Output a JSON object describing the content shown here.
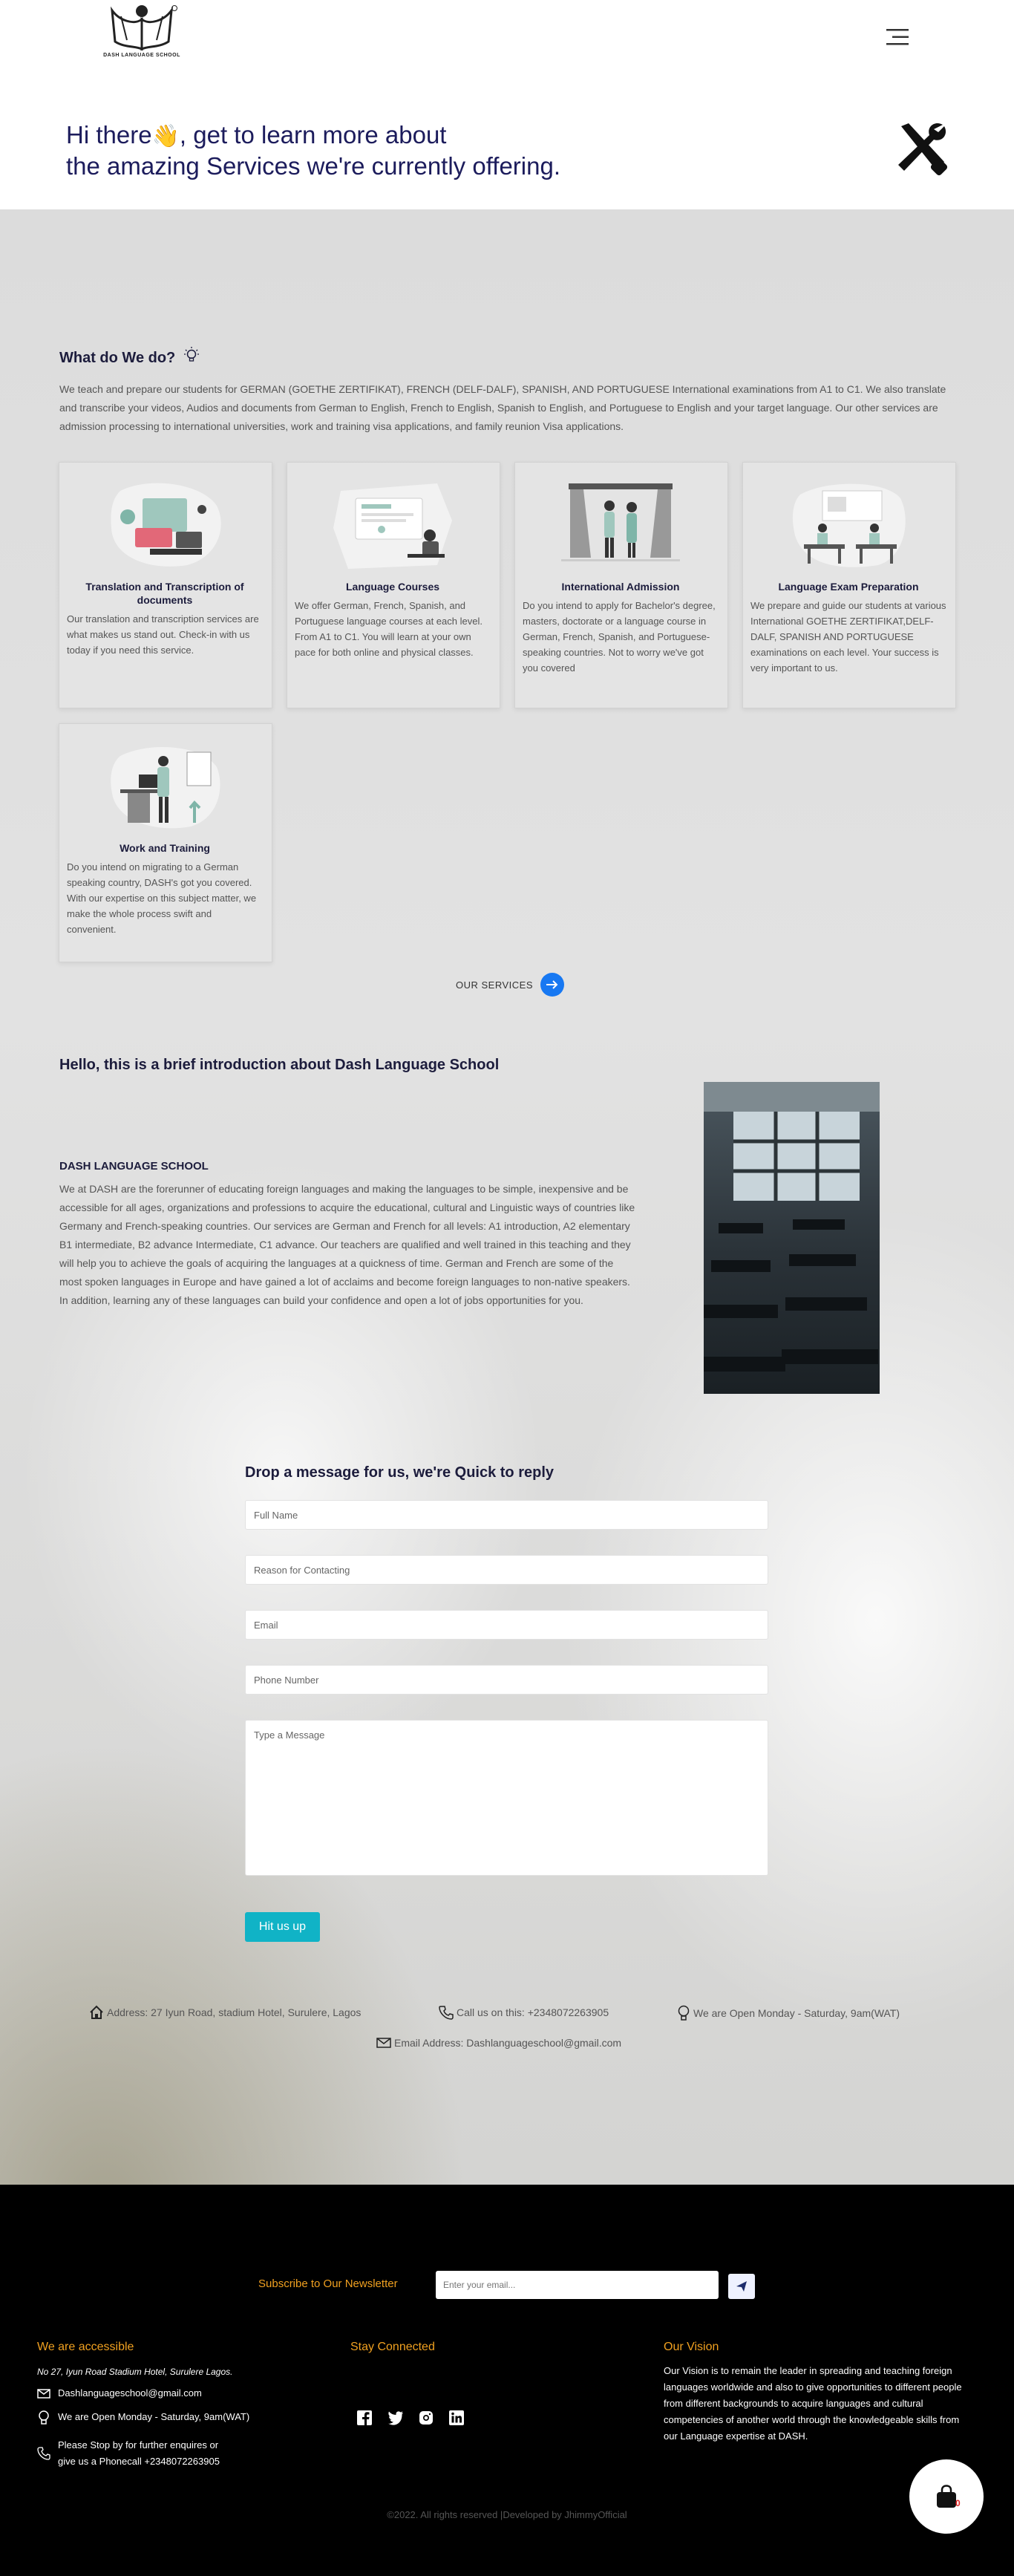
{
  "header": {
    "logo_text": "DASH LANGUAGE SCHOOL",
    "hero_line1": "Hi there",
    "hero_wave": "👋",
    "hero_line1_rest": ", get to learn more about",
    "hero_line2": "the amazing Services we're currently offering."
  },
  "about": {
    "heading": "What do We do?",
    "description": "We teach and prepare our students for GERMAN (GOETHE ZERTIFIKAT), FRENCH (DELF-DALF), SPANISH, AND PORTUGUESE International examinations from A1 to C1. We also translate and transcribe your videos, Audios and documents from German to English, French to English, Spanish to English, and Portuguese to English and your target language. Our other services are admission processing to international universities, work and training visa applications, and family reunion Visa applications."
  },
  "services": [
    {
      "title": "Translation and Transcription of documents",
      "text": "Our translation and transcription services are what makes us stand out. Check-in with us today if you need this service."
    },
    {
      "title": "Language Courses",
      "text": "We offer German, French, Spanish, and Portuguese language courses at each level. From A1 to C1. You will learn at your own pace for both online and physical classes."
    },
    {
      "title": "International Admission",
      "text": "Do you intend to apply for Bachelor's degree, masters, doctorate or a language course in German, French, Spanish, and Portuguese-speaking countries. Not to worry we've got you covered"
    },
    {
      "title": "Language Exam Preparation",
      "text": "We prepare and guide our students at various International GOETHE ZERTIFIKAT,DELF-DALF, SPANISH AND PORTUGUESE examinations on each level. Your success is very important to us."
    },
    {
      "title": "Work and Training",
      "text": "Do you intend on migrating to a German speaking country, DASH's got you covered. With our expertise on this subject matter, we make the whole process swift and convenient."
    }
  ],
  "our_services_label": "OUR SERVICES",
  "intro": {
    "heading": "Hello, this is a brief introduction about Dash Language School",
    "subheading": "DASH LANGUAGE SCHOOL",
    "text": "We at DASH are the forerunner of educating foreign languages and making the languages to be simple, inexpensive and be accessible for all ages, organizations and professions to acquire the educational, cultural and Linguistic ways of countries like Germany and French-speaking countries. Our services are German and French for all levels: A1 introduction, A2 elementary B1 intermediate, B2 advance Intermediate, C1 advance. Our teachers are qualified and well trained in this teaching and they will help you to achieve the goals of acquiring the languages at a quickness of time. German and French are some of the most spoken languages in Europe and have gained a lot of acclaims and become foreign languages to non-native speakers. In addition, learning any of these languages can build your confidence and open a lot of jobs opportunities for you."
  },
  "form": {
    "heading": "Drop a message for us, we're Quick to reply",
    "full_name_placeholder": "Full Name",
    "reason_placeholder": "Reason for Contacting",
    "email_placeholder": "Email",
    "phone_placeholder": "Phone Number",
    "message_placeholder": "Type a Message",
    "submit_label": "Hit us up"
  },
  "contact": {
    "address": "Address: 27 Iyun Road, stadium Hotel, Surulere, Lagos",
    "phone": "Call us on this: +2348072263905",
    "hours": "We are Open Monday - Saturday, 9am(WAT)",
    "email": "Email Address: Dashlanguageschool@gmail.com"
  },
  "footer": {
    "newsletter_label": "Subscribe to Our Newsletter",
    "newsletter_placeholder": "Enter your email...",
    "accessible_heading": "We are accessible",
    "address": "No 27, Iyun Road Stadium Hotel, Surulere Lagos.",
    "email": "Dashlanguageschool@gmail.com",
    "hours": "We are Open Monday - Saturday, 9am(WAT)",
    "phone_line1": "Please Stop by for further enquires or",
    "phone_line2": "give us a Phonecall +2348072263905",
    "connected_heading": "Stay Connected",
    "vision_heading": "Our Vision",
    "vision_text": "Our Vision is to remain the leader in spreading and teaching foreign languages worldwide and also to give opportunities to different people from different backgrounds to acquire languages and cultural competencies of another world through the knowledgeable skills from our Language expertise at DASH.",
    "copyright": "©2022. All rights reserved |Developed by JhimmyOfficial",
    "cart_count": "0"
  },
  "icons": {
    "header": [
      "logo-icon",
      "hamburger-menu-icon",
      "tools-icon"
    ],
    "contact": [
      "home-icon",
      "phone-icon",
      "lightbulb-icon",
      "envelope-icon"
    ],
    "social": [
      "facebook-icon",
      "twitter-icon",
      "instagram-icon",
      "linkedin-icon"
    ],
    "other": [
      "arrow-right-icon",
      "send-icon",
      "shopping-bag-icon"
    ]
  },
  "colors": {
    "accent_orange": "#f0a020",
    "button_teal": "#10b3c6",
    "arrow_blue": "#1778f2",
    "heading_navy": "#1c1c5c"
  }
}
